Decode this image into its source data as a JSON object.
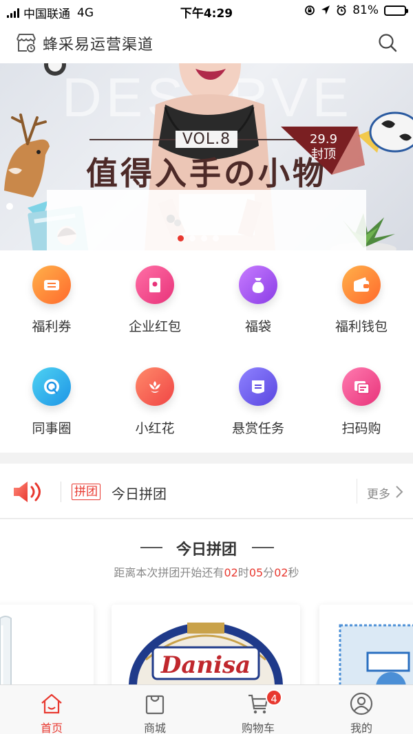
{
  "status_bar": {
    "carrier": "中国联通",
    "network": "4G",
    "time": "下午4:29",
    "battery": "81%",
    "battery_level": 0.81
  },
  "header": {
    "title": "蜂采易运营渠道",
    "store_icon": "store-icon",
    "search_icon": "search-icon"
  },
  "banner": {
    "bg_text": "DESERVE",
    "vol": "VOL.8",
    "headline": "值得入手の小物",
    "price": "29.9",
    "price_tag": "封顶",
    "pages": 4,
    "active_page": 0
  },
  "functions": [
    {
      "label": "福利券",
      "icon": "ticket-icon",
      "color_from": "#ffb14a",
      "color_to": "#ff6a2d"
    },
    {
      "label": "企业红包",
      "icon": "red-envelope-icon",
      "color_from": "#ff6fa6",
      "color_to": "#e8337a"
    },
    {
      "label": "福袋",
      "icon": "lucky-bag-icon",
      "color_from": "#c77bff",
      "color_to": "#8a3de6"
    },
    {
      "label": "福利钱包",
      "icon": "wallet-icon",
      "color_from": "#ffb14a",
      "color_to": "#ff6a2d"
    },
    {
      "label": "同事圈",
      "icon": "chat-bubble-icon",
      "color_from": "#4ed2f2",
      "color_to": "#1e95e6"
    },
    {
      "label": "小红花",
      "icon": "flower-icon",
      "color_from": "#ff8a6a",
      "color_to": "#f04545"
    },
    {
      "label": "悬赏任务",
      "icon": "task-icon",
      "color_from": "#8e82ff",
      "color_to": "#5a46e0"
    },
    {
      "label": "扫码购",
      "icon": "scan-buy-icon",
      "color_from": "#ff7bb0",
      "color_to": "#e8337a"
    }
  ],
  "notice": {
    "tag": "拼团",
    "text": "今日拼团",
    "more": "更多"
  },
  "group_buy": {
    "title": "今日拼团",
    "countdown_prefix": "距离本次拼团开始还有",
    "hours": "02",
    "hours_unit": "时",
    "minutes": "05",
    "minutes_unit": "分",
    "seconds": "02",
    "seconds_unit": "秒",
    "product_brand": "Danisa"
  },
  "tabs": [
    {
      "label": "首页",
      "icon": "home-icon",
      "active": true
    },
    {
      "label": "商城",
      "icon": "shopping-bag-icon",
      "active": false
    },
    {
      "label": "购物车",
      "icon": "cart-icon",
      "active": false,
      "badge": "4"
    },
    {
      "label": "我的",
      "icon": "user-icon",
      "active": false
    }
  ],
  "colors": {
    "accent": "#e8382f",
    "text": "#333333",
    "muted": "#888888"
  }
}
